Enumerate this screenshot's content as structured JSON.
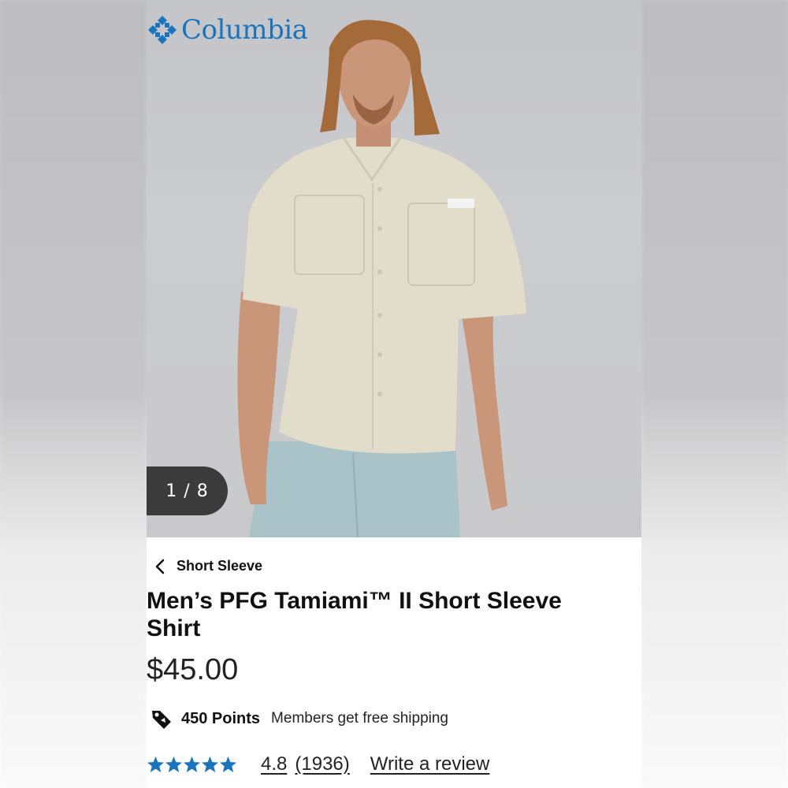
{
  "brand": {
    "name": "Columbia",
    "color": "#1b74bb"
  },
  "gallery": {
    "counter": "1 / 8"
  },
  "breadcrumb": {
    "label": "Short Sleeve",
    "icon": "chevron-left-icon"
  },
  "product": {
    "title": "Men’s PFG Tamiami™ II Short Sleeve Shirt",
    "price": "$45.00"
  },
  "rewards": {
    "icon": "tag-icon",
    "points": "450 Points",
    "shipping": "Members get free shipping"
  },
  "reviews": {
    "stars": 5,
    "rating": "4.8",
    "count": "(1936)",
    "write_label": "Write a review",
    "star_color": "#1b74bb"
  }
}
